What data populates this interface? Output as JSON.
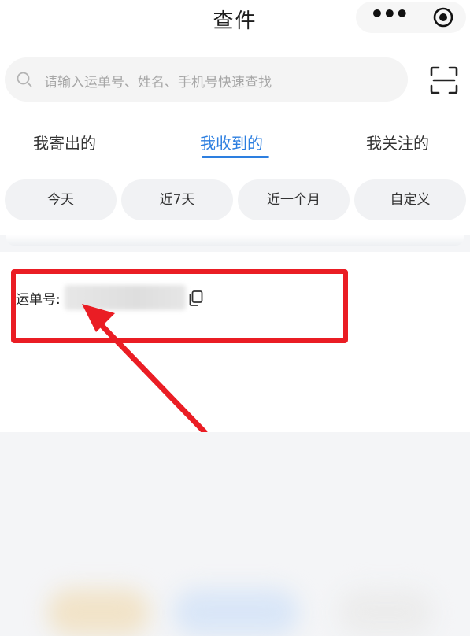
{
  "header": {
    "title": "查件",
    "more_icon": "more-dots-icon",
    "capsule_icon": "target-circle-icon"
  },
  "search": {
    "placeholder": "请输入运单号、姓名、手机号快速查找",
    "icon": "search-icon",
    "scan_icon": "scan-icon"
  },
  "tabs": [
    {
      "label": "我寄出的",
      "active": false
    },
    {
      "label": "我收到的",
      "active": true
    },
    {
      "label": "我关注的",
      "active": false
    }
  ],
  "filters": [
    {
      "label": "今天"
    },
    {
      "label": "近7天"
    },
    {
      "label": "近一个月"
    },
    {
      "label": "自定义"
    }
  ],
  "card": {
    "waybill_label": "运单号:",
    "copy_icon": "copy-icon"
  },
  "colors": {
    "accent": "#2d7fe0",
    "highlight": "#ea1d24"
  }
}
